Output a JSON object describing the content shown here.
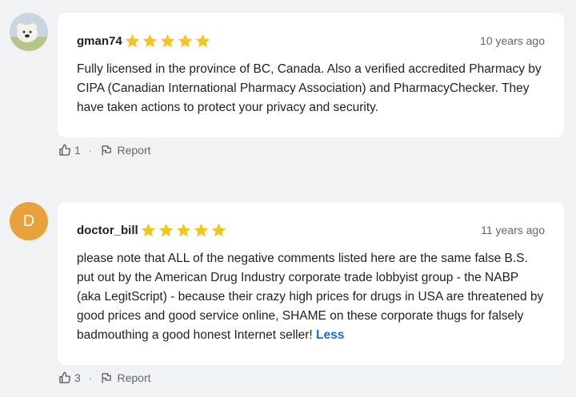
{
  "reviews": [
    {
      "username": "gman74",
      "rating": 5,
      "time": "10 years ago",
      "text": "Fully licensed in the province of BC, Canada. Also a verified accredited Pharmacy by CIPA (Canadian International Pharmacy Association) and PharmacyChecker. They have taken actions to protect your privacy and security.",
      "likes": "1",
      "report_label": "Report"
    },
    {
      "username": "doctor_bill",
      "avatar_letter": "D",
      "rating": 5,
      "time": "11 years ago",
      "text": "please note that ALL of the negative comments listed here are the same false B.S. put out by the American Drug Industry corporate trade lobbyist group - the NABP (aka LegitScript) - because their crazy high prices for drugs in USA are threatened by good prices and good service online, SHAME on these corporate thugs for falsely badmouthing a good honest Internet seller!",
      "less_label": "Less",
      "likes": "3",
      "report_label": "Report"
    }
  ],
  "colors": {
    "star": "#f5c518",
    "avatar_bg": "#e9a23b",
    "link": "#1b6ecf"
  },
  "icons": [
    "thumbs-up-icon",
    "flag-icon",
    "star-icon"
  ]
}
